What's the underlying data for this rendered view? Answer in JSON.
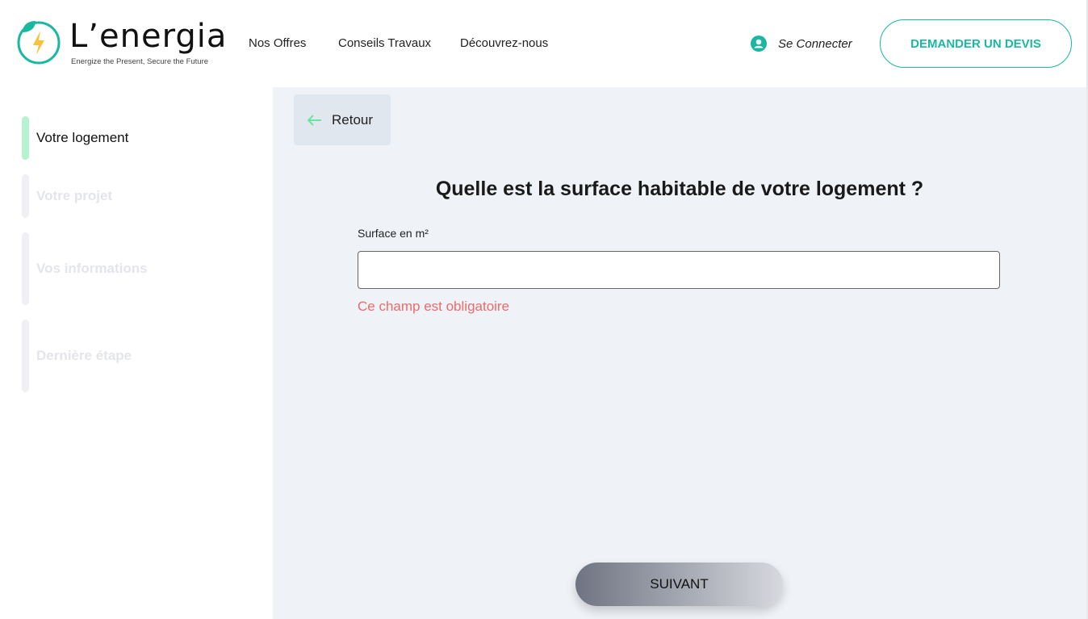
{
  "header": {
    "logo_text": "L’energia",
    "logo_tagline": "Energize the Present, Secure the Future",
    "nav": [
      "Nos Offres",
      "Conseils Travaux",
      "Découvrez-nous"
    ],
    "connect_label": "Se Connecter",
    "cta_label": "DEMANDER UN DEVIS"
  },
  "sidebar": {
    "steps": [
      {
        "label": "Votre logement",
        "active": true
      },
      {
        "label": "Votre projet",
        "active": false
      },
      {
        "label": "Vos informations",
        "active": false
      },
      {
        "label": "Dernière étape",
        "active": false
      }
    ]
  },
  "main": {
    "back_label": "Retour",
    "question": "Quelle est la surface habitable de votre logement ?",
    "field_label": "Surface en m²",
    "field_value": "",
    "error": "Ce champ est obligatoire",
    "next_label": "SUIVANT"
  },
  "colors": {
    "accent": "#1ab8a0",
    "active_step": "#b5f2d0",
    "error": "#ec6b6b"
  }
}
